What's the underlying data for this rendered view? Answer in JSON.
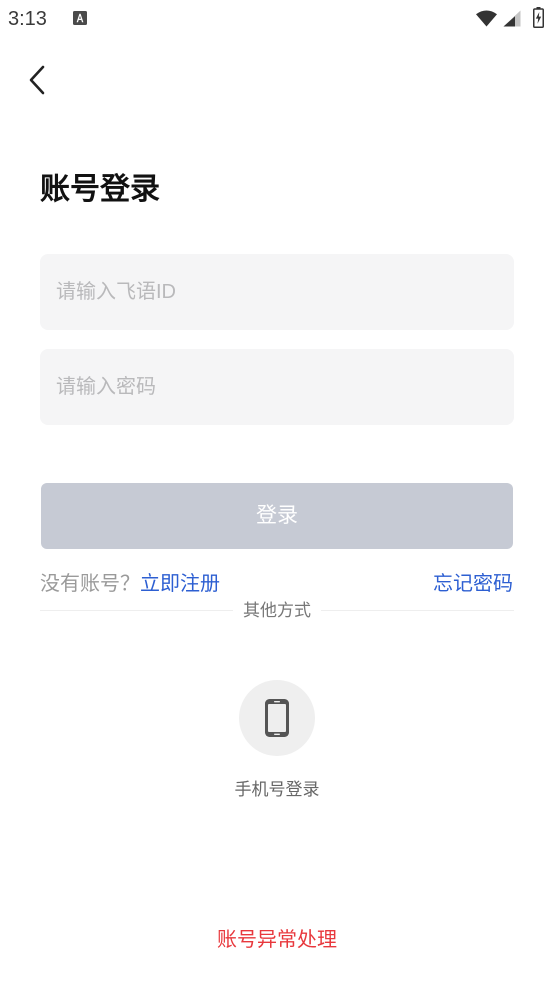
{
  "status_bar": {
    "time": "3:13",
    "notification_icon": "a-box-icon",
    "wifi_icon": "wifi-icon",
    "signal_icon": "signal-icon",
    "battery_icon": "battery-charging-icon"
  },
  "nav": {
    "back_icon": "chevron-left-icon"
  },
  "page": {
    "title": "账号登录"
  },
  "form": {
    "id_field": {
      "value": "",
      "placeholder": "请输入飞语ID"
    },
    "password_field": {
      "value": "",
      "placeholder": "请输入密码"
    },
    "login_label": "登录"
  },
  "links": {
    "no_account_text": "没有账号？",
    "register_label": "立即注册",
    "forgot_password_label": "忘记密码"
  },
  "other_methods": {
    "divider_label": "其他方式",
    "options": [
      {
        "icon": "phone-icon",
        "label": "手机号登录"
      }
    ]
  },
  "footer": {
    "account_issue_label": "账号异常处理"
  },
  "colors": {
    "input_background": "#f5f5f6",
    "login_button_disabled": "#c6cad4",
    "link_blue": "#2d5fd2",
    "muted_text": "#9a9a9a",
    "danger_red": "#e8383d",
    "option_circle": "#efefef"
  }
}
